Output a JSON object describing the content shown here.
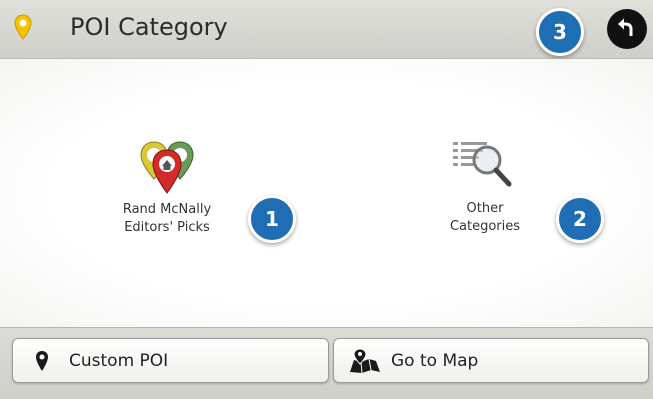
{
  "header": {
    "title": "POI Category",
    "pin_icon": "map-pin-icon",
    "back_icon": "back-arrow-icon"
  },
  "tiles": [
    {
      "line1": "Rand McNally",
      "line2": "Editors' Picks",
      "icon": "editors-picks-pins-icon"
    },
    {
      "line1": "Other",
      "line2": "Categories",
      "icon": "list-magnifier-icon"
    }
  ],
  "callouts": [
    "1",
    "2",
    "3"
  ],
  "footer": {
    "custom_poi": "Custom POI",
    "go_to_map": "Go to Map"
  },
  "colors": {
    "callout": "#1f6db2",
    "pin": "#f5c400",
    "header": "#d8d8d3"
  }
}
